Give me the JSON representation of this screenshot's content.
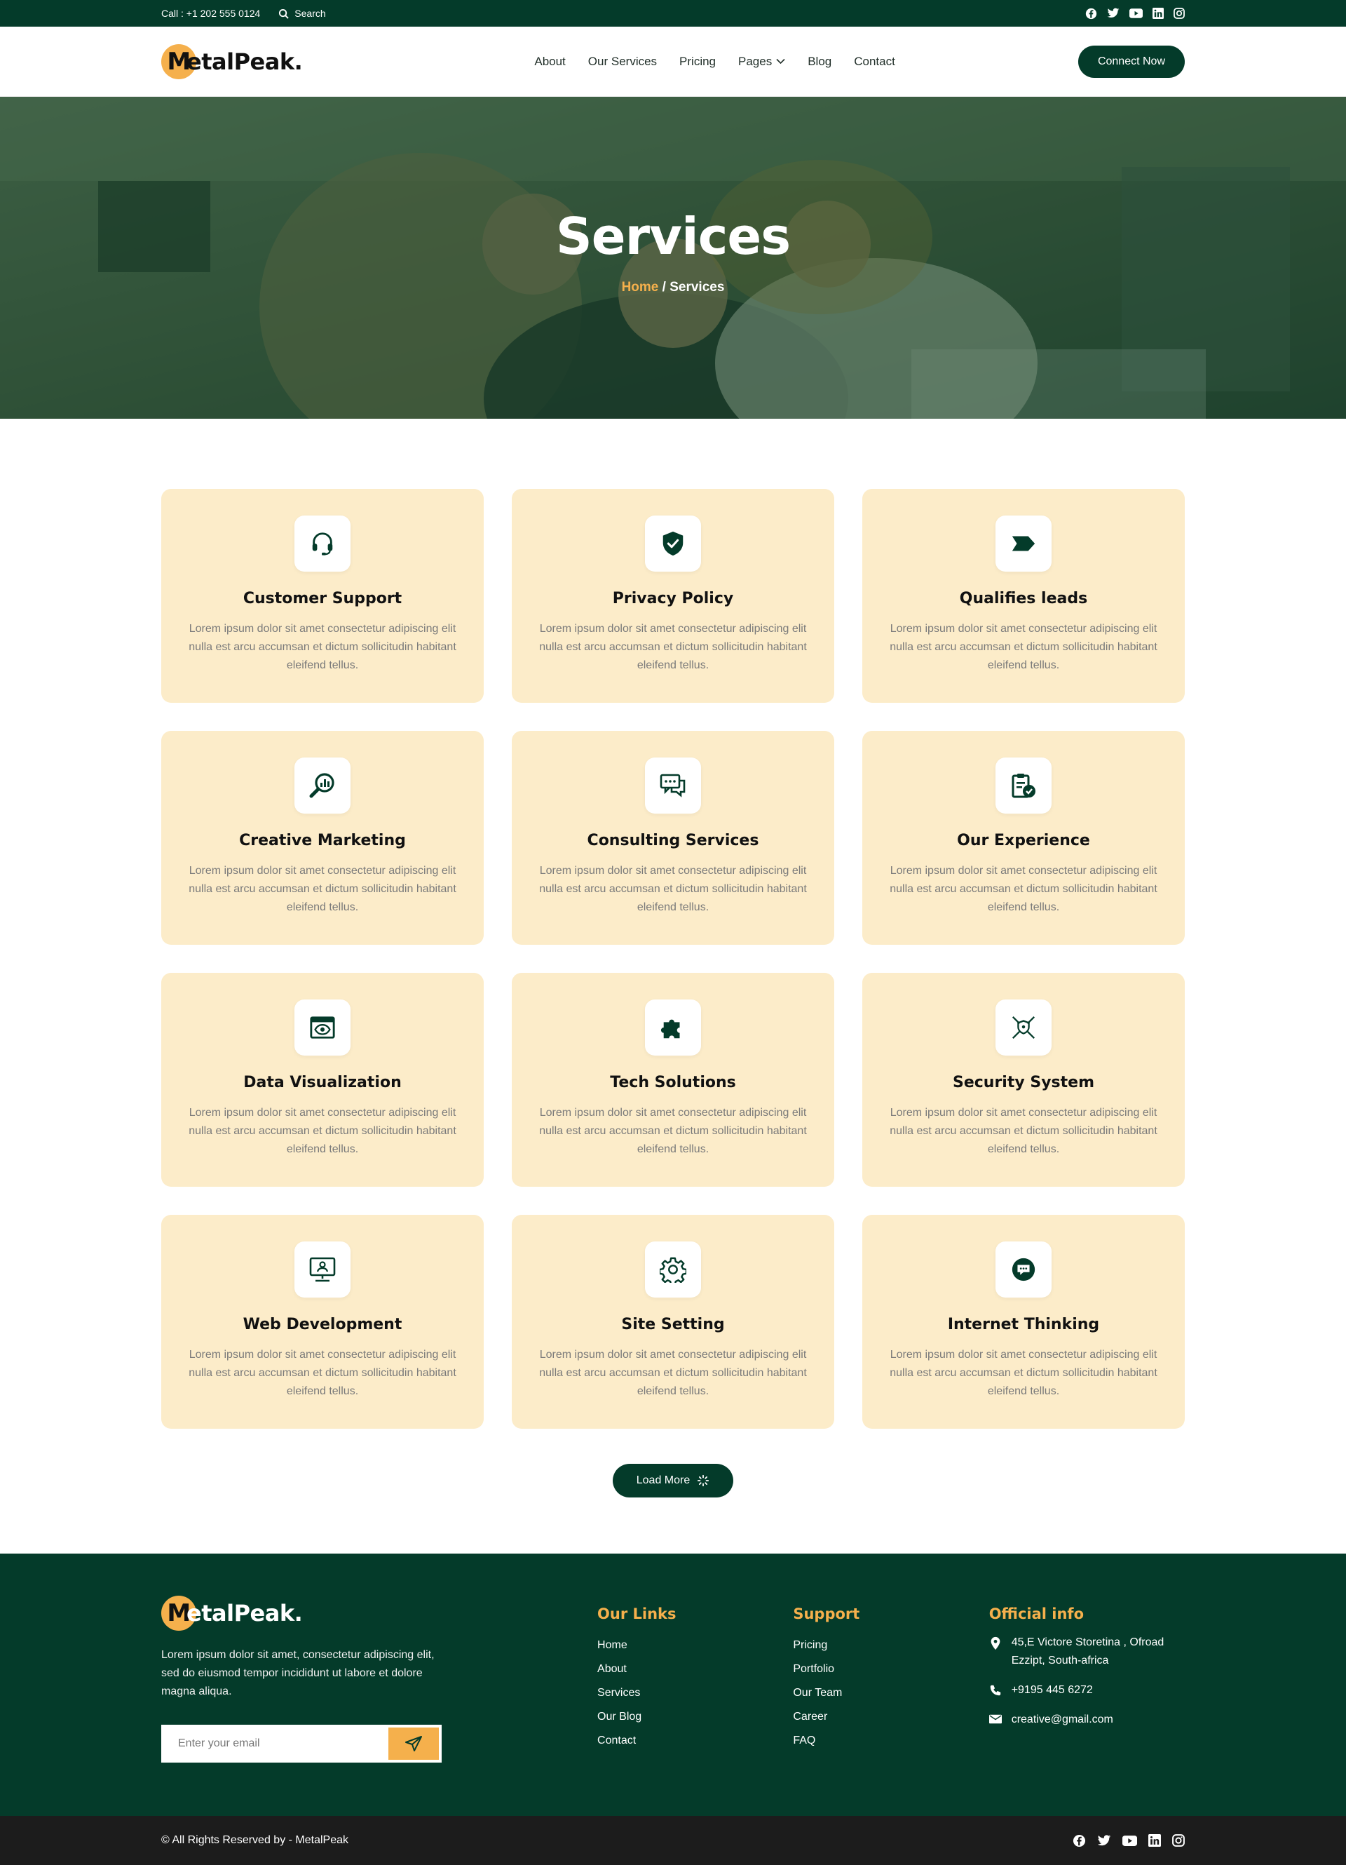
{
  "topbar": {
    "call": "Call : +1 202 555 0124",
    "search_label": "Search",
    "socials": [
      "facebook-icon",
      "twitter-icon",
      "youtube-icon",
      "linkedin-icon",
      "instagram-icon"
    ]
  },
  "brand": {
    "logo_initial": "M",
    "logo_rest": "etalPeak."
  },
  "nav": {
    "items": [
      {
        "label": "About"
      },
      {
        "label": "Our Services"
      },
      {
        "label": "Pricing"
      },
      {
        "label": "Pages"
      },
      {
        "label": "Blog"
      },
      {
        "label": "Contact"
      }
    ],
    "cta": "Connect Now"
  },
  "hero": {
    "title": "Services",
    "breadcrumb_home": "Home",
    "breadcrumb_sep": " / ",
    "breadcrumb_current": "Services"
  },
  "services": [
    {
      "title": "Customer Support",
      "icon": "headset-icon",
      "text": "Lorem ipsum dolor sit amet consectetur adipiscing elit nulla est arcu accumsan et dictum sollicitudin habitant eleifend tellus."
    },
    {
      "title": "Privacy Policy",
      "icon": "shield-check-icon",
      "text": "Lorem ipsum dolor sit amet consectetur adipiscing elit nulla est arcu accumsan et dictum sollicitudin habitant eleifend tellus."
    },
    {
      "title": "Qualifies leads",
      "icon": "tag-icon",
      "text": "Lorem ipsum dolor sit amet consectetur adipiscing elit nulla est arcu accumsan et dictum sollicitudin habitant eleifend tellus."
    },
    {
      "title": "Creative Marketing",
      "icon": "search-chart-icon",
      "text": "Lorem ipsum dolor sit amet consectetur adipiscing elit nulla est arcu accumsan et dictum sollicitudin habitant eleifend tellus."
    },
    {
      "title": "Consulting Services",
      "icon": "chat-bubbles-icon",
      "text": "Lorem ipsum dolor sit amet consectetur adipiscing elit nulla est arcu accumsan et dictum sollicitudin habitant eleifend tellus."
    },
    {
      "title": "Our Experience",
      "icon": "clipboard-check-icon",
      "text": "Lorem ipsum dolor sit amet consectetur adipiscing elit nulla est arcu accumsan et dictum sollicitudin habitant eleifend tellus."
    },
    {
      "title": "Data Visualization",
      "icon": "browser-eye-icon",
      "text": "Lorem ipsum dolor sit amet consectetur adipiscing elit nulla est arcu accumsan et dictum sollicitudin habitant eleifend tellus."
    },
    {
      "title": "Tech Solutions",
      "icon": "puzzle-icon",
      "text": "Lorem ipsum dolor sit amet consectetur adipiscing elit nulla est arcu accumsan et dictum sollicitudin habitant eleifend tellus."
    },
    {
      "title": "Security System",
      "icon": "security-network-icon",
      "text": "Lorem ipsum dolor sit amet consectetur adipiscing elit nulla est arcu accumsan et dictum sollicitudin habitant eleifend tellus."
    },
    {
      "title": "Web Development",
      "icon": "monitor-user-icon",
      "text": "Lorem ipsum dolor sit amet consectetur adipiscing elit nulla est arcu accumsan et dictum sollicitudin habitant eleifend tellus."
    },
    {
      "title": "Site Setting",
      "icon": "gear-icon",
      "text": "Lorem ipsum dolor sit amet consectetur adipiscing elit nulla est arcu accumsan et dictum sollicitudin habitant eleifend tellus."
    },
    {
      "title": "Internet Thinking",
      "icon": "chat-dots-icon",
      "text": "Lorem ipsum dolor sit amet consectetur adipiscing elit nulla est arcu accumsan et dictum sollicitudin habitant eleifend tellus."
    }
  ],
  "load_more": "Load More",
  "footer": {
    "description": "Lorem ipsum dolor sit amet, consectetur adipiscing elit, sed do eiusmod tempor incididunt ut labore et dolore magna aliqua.",
    "email_placeholder": "Enter your email",
    "links_title": "Our Links",
    "links": [
      "Home",
      "About",
      "Services",
      "Our Blog",
      "Contact"
    ],
    "support_title": "Support",
    "support": [
      "Pricing",
      "Portfolio",
      "Our Team",
      "Career",
      "FAQ"
    ],
    "info_title": "Official info",
    "address": "45,E Victore Storetina , Ofroad Ezzipt, South-africa",
    "phone": "+9195 445 6272",
    "email": "creative@gmail.com"
  },
  "copyright": "© All Rights Reserved by - MetalPeak",
  "colors": {
    "primary": "#043b2a",
    "accent": "#f5b04c",
    "card_bg": "#fcecc9",
    "bottom_bar": "#1c1c1c"
  }
}
